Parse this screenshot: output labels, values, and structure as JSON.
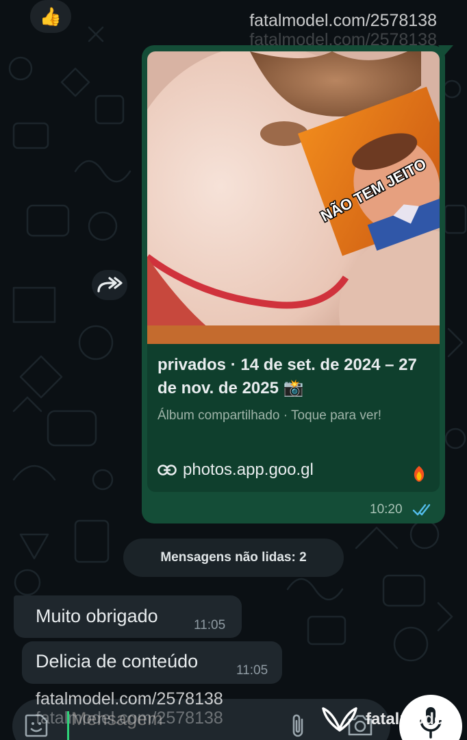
{
  "watermark": {
    "top_text": "fatalmodel.com/2578138",
    "bottom_text": "fatalmodel.com/2578138",
    "brand_name": "fatalmodel"
  },
  "reaction": {
    "emoji": "👍"
  },
  "outgoing_message": {
    "link_preview": {
      "title": "privados · 14 de set. de 2024 – 27 de nov. de 2025 📸",
      "description": "Álbum compartilhado · Toque para ver!",
      "url": "photos.app.goo.gl",
      "image_caption": "NÃO TEM JEITO"
    },
    "time": "10:20",
    "status": "read"
  },
  "unread_divider": {
    "label": "Mensagens não lidas: 2"
  },
  "incoming_messages": [
    {
      "text": "Muito obrigado",
      "time": "11:05"
    },
    {
      "text": "Delicia de conteúdo",
      "time": "11:05"
    }
  ],
  "composer": {
    "placeholder": "Mensagem"
  },
  "icons": {
    "forward": "forward-icon",
    "link": "link-icon",
    "favicon": "photos-favicon-icon",
    "ticks": "double-check-icon",
    "emoji": "sticker-icon",
    "attach": "paperclip-icon",
    "camera": "camera-icon",
    "mic": "microphone-icon"
  },
  "colors": {
    "background": "#0b1014",
    "outgoing_bubble": "#144d37",
    "incoming_bubble": "#1f272d",
    "read_ticks": "#53bdeb",
    "accent": "#2fd279"
  }
}
